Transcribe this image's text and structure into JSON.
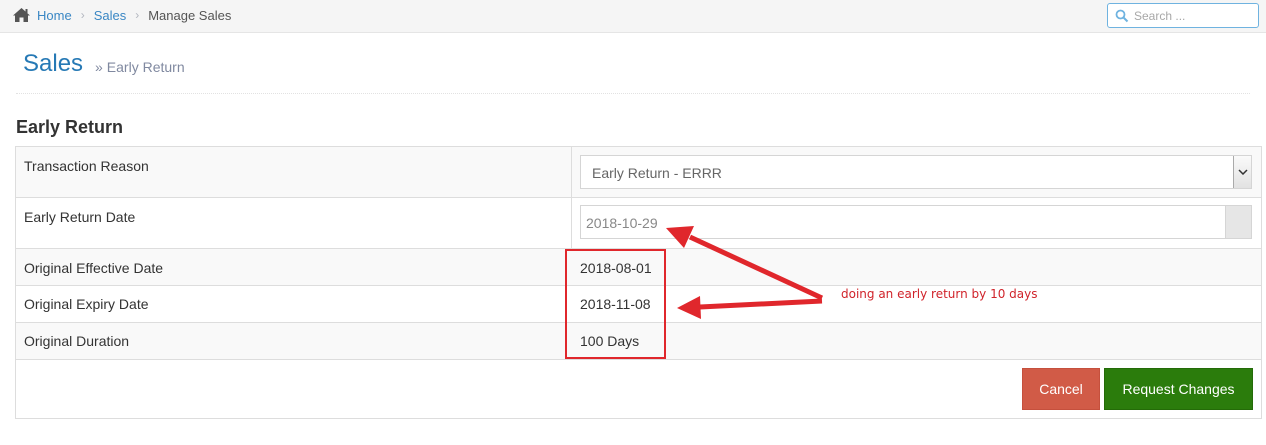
{
  "breadcrumb": {
    "home": "Home",
    "sales": "Sales",
    "current": "Manage Sales"
  },
  "search": {
    "placeholder": "Search ..."
  },
  "header": {
    "title": "Sales",
    "subtitle_marker": "»",
    "subtitle": "Early Return"
  },
  "section": {
    "title": "Early Return"
  },
  "form": {
    "transaction_reason_label": "Transaction Reason",
    "transaction_reason_value": "Early Return - ERRR",
    "early_return_date_label": "Early Return Date",
    "early_return_date_value": "2018-10-29",
    "original_effective_label": "Original Effective Date",
    "original_effective_value": "2018-08-01",
    "original_expiry_label": "Original Expiry Date",
    "original_expiry_value": "2018-11-08",
    "original_duration_label": "Original Duration",
    "original_duration_value": "100 Days"
  },
  "buttons": {
    "cancel": "Cancel",
    "request_changes": "Request Changes"
  },
  "annotation": {
    "text": "doing an early return by 10 days",
    "color": "#e0272c"
  },
  "colors": {
    "link": "#3a87c4",
    "title": "#2679b5",
    "cancel": "#d15b47",
    "request": "#2b7c0c"
  }
}
